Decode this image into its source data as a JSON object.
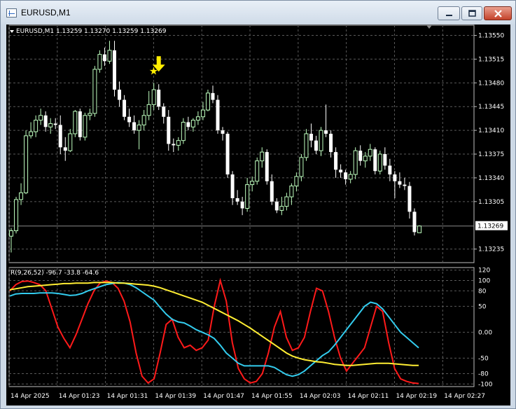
{
  "window": {
    "title": "EURUSD,M1",
    "buttons": {
      "minimize": "minimize",
      "maximize": "maximize",
      "close": "close"
    }
  },
  "colors": {
    "background": "#000000",
    "grid": "#5a5a5a",
    "bull_candle": "#bfffbf",
    "bear_candle": "#ffffff",
    "axis_text": "#ffffff",
    "red_line": "#ff1a1a",
    "cyan_line": "#33ccee",
    "yellow_line": "#ffee33",
    "marker": "#ffee00",
    "current_price_box": "#ffffff"
  },
  "chart_data": [
    {
      "type": "candlestick",
      "title": "EURUSD,M1",
      "header_values": "1.13259 1.13270 1.13259 1.13269",
      "current_price": "1.13269",
      "y_ticks": [
        "1.13550",
        "1.13515",
        "1.13480",
        "1.13445",
        "1.13410",
        "1.13375",
        "1.13340",
        "1.13305",
        "1.13235"
      ],
      "ylim": [
        1.13215,
        1.13565
      ],
      "x_ticks": [
        "14 Apr 2025",
        "14 Apr 01:23",
        "14 Apr 01:31",
        "14 Apr 01:39",
        "14 Apr 01:47",
        "14 Apr 01:55",
        "14 Apr 02:03",
        "14 Apr 02:11",
        "14 Apr 02:19",
        "14 Apr 02:27"
      ],
      "grid": true,
      "candles": [
        {
          "o": 1.13254,
          "h": 1.13266,
          "l": 1.1323,
          "c": 1.13262
        },
        {
          "o": 1.13262,
          "h": 1.13312,
          "l": 1.13258,
          "c": 1.13308
        },
        {
          "o": 1.13308,
          "h": 1.13332,
          "l": 1.133,
          "c": 1.13318
        },
        {
          "o": 1.13318,
          "h": 1.1341,
          "l": 1.13316,
          "c": 1.13402
        },
        {
          "o": 1.13402,
          "h": 1.13422,
          "l": 1.13398,
          "c": 1.13408
        },
        {
          "o": 1.13408,
          "h": 1.13432,
          "l": 1.134,
          "c": 1.13425
        },
        {
          "o": 1.13425,
          "h": 1.13442,
          "l": 1.13418,
          "c": 1.13432
        },
        {
          "o": 1.13432,
          "h": 1.13438,
          "l": 1.13408,
          "c": 1.13415
        },
        {
          "o": 1.13415,
          "h": 1.13428,
          "l": 1.13405,
          "c": 1.1342
        },
        {
          "o": 1.1342,
          "h": 1.13428,
          "l": 1.13412,
          "c": 1.13418
        },
        {
          "o": 1.13418,
          "h": 1.13432,
          "l": 1.13375,
          "c": 1.13385
        },
        {
          "o": 1.13385,
          "h": 1.134,
          "l": 1.13365,
          "c": 1.1338
        },
        {
          "o": 1.1338,
          "h": 1.13412,
          "l": 1.13378,
          "c": 1.13405
        },
        {
          "o": 1.13405,
          "h": 1.1344,
          "l": 1.134,
          "c": 1.13438
        },
        {
          "o": 1.13438,
          "h": 1.13442,
          "l": 1.13395,
          "c": 1.134
        },
        {
          "o": 1.134,
          "h": 1.13436,
          "l": 1.13395,
          "c": 1.13432
        },
        {
          "o": 1.13432,
          "h": 1.13442,
          "l": 1.13425,
          "c": 1.13435
        },
        {
          "o": 1.13435,
          "h": 1.13505,
          "l": 1.1343,
          "c": 1.135
        },
        {
          "o": 1.135,
          "h": 1.13528,
          "l": 1.13495,
          "c": 1.13522
        },
        {
          "o": 1.13522,
          "h": 1.13532,
          "l": 1.13505,
          "c": 1.13512
        },
        {
          "o": 1.13512,
          "h": 1.13542,
          "l": 1.13508,
          "c": 1.13528
        },
        {
          "o": 1.13528,
          "h": 1.13542,
          "l": 1.1346,
          "c": 1.1347
        },
        {
          "o": 1.1347,
          "h": 1.13482,
          "l": 1.13445,
          "c": 1.13455
        },
        {
          "o": 1.13455,
          "h": 1.13462,
          "l": 1.13425,
          "c": 1.1343
        },
        {
          "o": 1.1343,
          "h": 1.13442,
          "l": 1.13415,
          "c": 1.13422
        },
        {
          "o": 1.13422,
          "h": 1.13432,
          "l": 1.13405,
          "c": 1.1341
        },
        {
          "o": 1.1341,
          "h": 1.13425,
          "l": 1.13382,
          "c": 1.13418
        },
        {
          "o": 1.13418,
          "h": 1.1344,
          "l": 1.1341,
          "c": 1.13432
        },
        {
          "o": 1.13432,
          "h": 1.13468,
          "l": 1.13425,
          "c": 1.13448
        },
        {
          "o": 1.13448,
          "h": 1.1348,
          "l": 1.1344,
          "c": 1.1347
        },
        {
          "o": 1.1347,
          "h": 1.13478,
          "l": 1.1344,
          "c": 1.13445
        },
        {
          "o": 1.13445,
          "h": 1.1345,
          "l": 1.1342,
          "c": 1.1343
        },
        {
          "o": 1.1343,
          "h": 1.1344,
          "l": 1.1338,
          "c": 1.1339
        },
        {
          "o": 1.1339,
          "h": 1.13398,
          "l": 1.13378,
          "c": 1.13388
        },
        {
          "o": 1.13388,
          "h": 1.134,
          "l": 1.1338,
          "c": 1.13395
        },
        {
          "o": 1.13395,
          "h": 1.13428,
          "l": 1.1339,
          "c": 1.13422
        },
        {
          "o": 1.13422,
          "h": 1.1343,
          "l": 1.1341,
          "c": 1.13415
        },
        {
          "o": 1.13415,
          "h": 1.13428,
          "l": 1.13408,
          "c": 1.13425
        },
        {
          "o": 1.13425,
          "h": 1.13438,
          "l": 1.13418,
          "c": 1.1343
        },
        {
          "o": 1.1343,
          "h": 1.13452,
          "l": 1.13425,
          "c": 1.1344
        },
        {
          "o": 1.1344,
          "h": 1.1347,
          "l": 1.13438,
          "c": 1.13465
        },
        {
          "o": 1.13465,
          "h": 1.13476,
          "l": 1.1345,
          "c": 1.13455
        },
        {
          "o": 1.13455,
          "h": 1.13462,
          "l": 1.13405,
          "c": 1.1341
        },
        {
          "o": 1.1341,
          "h": 1.13415,
          "l": 1.13395,
          "c": 1.13405
        },
        {
          "o": 1.13405,
          "h": 1.13408,
          "l": 1.1334,
          "c": 1.13345
        },
        {
          "o": 1.13345,
          "h": 1.1335,
          "l": 1.133,
          "c": 1.1331
        },
        {
          "o": 1.1331,
          "h": 1.13322,
          "l": 1.133,
          "c": 1.13305
        },
        {
          "o": 1.13305,
          "h": 1.13312,
          "l": 1.13285,
          "c": 1.13295
        },
        {
          "o": 1.13295,
          "h": 1.1334,
          "l": 1.1329,
          "c": 1.1333
        },
        {
          "o": 1.1333,
          "h": 1.13342,
          "l": 1.1332,
          "c": 1.13335
        },
        {
          "o": 1.13335,
          "h": 1.1337,
          "l": 1.1333,
          "c": 1.13365
        },
        {
          "o": 1.13365,
          "h": 1.13385,
          "l": 1.13355,
          "c": 1.13378
        },
        {
          "o": 1.13378,
          "h": 1.13382,
          "l": 1.1333,
          "c": 1.13335
        },
        {
          "o": 1.13335,
          "h": 1.13345,
          "l": 1.133,
          "c": 1.13305
        },
        {
          "o": 1.13305,
          "h": 1.1331,
          "l": 1.13288,
          "c": 1.13292
        },
        {
          "o": 1.13292,
          "h": 1.13312,
          "l": 1.13285,
          "c": 1.13298
        },
        {
          "o": 1.13298,
          "h": 1.13318,
          "l": 1.13292,
          "c": 1.13312
        },
        {
          "o": 1.13312,
          "h": 1.13332,
          "l": 1.133,
          "c": 1.13328
        },
        {
          "o": 1.13328,
          "h": 1.13348,
          "l": 1.1332,
          "c": 1.13342
        },
        {
          "o": 1.13342,
          "h": 1.13375,
          "l": 1.13335,
          "c": 1.1337
        },
        {
          "o": 1.1337,
          "h": 1.13412,
          "l": 1.13365,
          "c": 1.13405
        },
        {
          "o": 1.13405,
          "h": 1.1342,
          "l": 1.13385,
          "c": 1.13395
        },
        {
          "o": 1.13395,
          "h": 1.13402,
          "l": 1.13375,
          "c": 1.1338
        },
        {
          "o": 1.1338,
          "h": 1.13415,
          "l": 1.13372,
          "c": 1.1341
        },
        {
          "o": 1.1341,
          "h": 1.13448,
          "l": 1.134,
          "c": 1.13405
        },
        {
          "o": 1.13405,
          "h": 1.1341,
          "l": 1.1337,
          "c": 1.13378
        },
        {
          "o": 1.13378,
          "h": 1.13385,
          "l": 1.1334,
          "c": 1.13352
        },
        {
          "o": 1.13352,
          "h": 1.1336,
          "l": 1.1334,
          "c": 1.13348
        },
        {
          "o": 1.13348,
          "h": 1.13352,
          "l": 1.1333,
          "c": 1.13338
        },
        {
          "o": 1.13338,
          "h": 1.1335,
          "l": 1.13332,
          "c": 1.13345
        },
        {
          "o": 1.13345,
          "h": 1.13385,
          "l": 1.13338,
          "c": 1.1338
        },
        {
          "o": 1.1338,
          "h": 1.13388,
          "l": 1.13358,
          "c": 1.13365
        },
        {
          "o": 1.13365,
          "h": 1.13378,
          "l": 1.13355,
          "c": 1.13372
        },
        {
          "o": 1.13372,
          "h": 1.1339,
          "l": 1.13365,
          "c": 1.13382
        },
        {
          "o": 1.13382,
          "h": 1.13385,
          "l": 1.13345,
          "c": 1.1335
        },
        {
          "o": 1.1335,
          "h": 1.1338,
          "l": 1.13345,
          "c": 1.13375
        },
        {
          "o": 1.13375,
          "h": 1.13385,
          "l": 1.13352,
          "c": 1.13358
        },
        {
          "o": 1.13358,
          "h": 1.13368,
          "l": 1.13335,
          "c": 1.13345
        },
        {
          "o": 1.13345,
          "h": 1.1335,
          "l": 1.1331,
          "c": 1.13335
        },
        {
          "o": 1.13335,
          "h": 1.13348,
          "l": 1.13325,
          "c": 1.1333
        },
        {
          "o": 1.1333,
          "h": 1.1334,
          "l": 1.13322,
          "c": 1.13328
        },
        {
          "o": 1.13328,
          "h": 1.13334,
          "l": 1.1328,
          "c": 1.1329
        },
        {
          "o": 1.1329,
          "h": 1.13295,
          "l": 1.13255,
          "c": 1.1326
        },
        {
          "o": 1.13259,
          "h": 1.1327,
          "l": 1.13259,
          "c": 1.13269
        }
      ],
      "annotations": [
        {
          "kind": "star",
          "label": "★",
          "candle_index": 29
        },
        {
          "kind": "arrow-down",
          "label": "sell-arrow",
          "candle_index": 30
        }
      ]
    },
    {
      "type": "line",
      "title": "R(9,26,52) -96.7 -33.8 -64.6",
      "y_ticks": [
        "120",
        "100",
        "80",
        "50",
        "0.00",
        "-50",
        "-80",
        "-100"
      ],
      "ylim": [
        -105,
        125
      ],
      "series": [
        {
          "color": "#ff1a1a",
          "values": [
            80,
            92,
            98,
            99,
            96,
            92,
            80,
            45,
            10,
            -12,
            -30,
            -5,
            25,
            55,
            80,
            95,
            99,
            96,
            85,
            60,
            20,
            -40,
            -85,
            -98,
            -90,
            -40,
            15,
            25,
            -10,
            -30,
            -25,
            -35,
            -30,
            -15,
            50,
            100,
            60,
            -20,
            -70,
            -90,
            -98,
            -95,
            -80,
            -40,
            10,
            40,
            -10,
            -35,
            -30,
            -10,
            40,
            85,
            80,
            40,
            -10,
            -50,
            -75,
            -60,
            -45,
            -30,
            10,
            50,
            40,
            -20,
            -70,
            -90,
            -95,
            -98,
            -99
          ]
        },
        {
          "color": "#33ccee",
          "values": [
            70,
            74,
            75,
            75,
            75,
            76,
            76,
            76,
            75,
            73,
            71,
            72,
            75,
            80,
            84,
            88,
            92,
            94,
            96,
            95,
            92,
            86,
            78,
            70,
            62,
            48,
            35,
            25,
            20,
            18,
            12,
            5,
            0,
            -5,
            -12,
            -25,
            -40,
            -50,
            -60,
            -65,
            -65,
            -65,
            -65,
            -65,
            -68,
            -75,
            -82,
            -85,
            -82,
            -75,
            -65,
            -55,
            -45,
            -38,
            -25,
            -10,
            5,
            20,
            35,
            50,
            58,
            55,
            45,
            30,
            15,
            0,
            -10,
            -20,
            -30
          ]
        },
        {
          "color": "#ffee33",
          "values": [
            82,
            84,
            86,
            88,
            89,
            90,
            91,
            92,
            93,
            94,
            94,
            95,
            95,
            95,
            96,
            96,
            96,
            96,
            95,
            95,
            94,
            93,
            92,
            91,
            89,
            86,
            82,
            78,
            74,
            70,
            66,
            62,
            58,
            52,
            46,
            40,
            34,
            28,
            22,
            15,
            8,
            0,
            -8,
            -16,
            -24,
            -32,
            -40,
            -46,
            -50,
            -53,
            -55,
            -57,
            -58,
            -60,
            -62,
            -63,
            -64,
            -64,
            -63,
            -62,
            -61,
            -60,
            -60,
            -60,
            -61,
            -62,
            -63,
            -64,
            -64
          ]
        }
      ],
      "grid": true
    }
  ]
}
